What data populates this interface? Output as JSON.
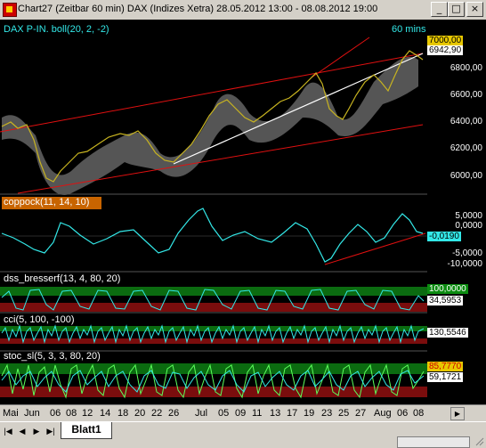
{
  "window": {
    "title": "Chart27 (Zeitbar 60 min)  DAX (Indizes Xetra) 28.05.2012 13:00 - 08.08.2012 19:00",
    "min_label": "_",
    "max_label": "□",
    "close_label": "×"
  },
  "main_panel": {
    "label": "DAX P-IN.  boll(20, 2, -2)",
    "interval": "60 mins",
    "price_tags": [
      "7000,00",
      "6942,90"
    ],
    "scale": [
      "6800,00",
      "6600,00",
      "6400,00",
      "6200,00",
      "6000,00"
    ]
  },
  "coppock": {
    "label": "coppock(11, 14, 10)",
    "value_tag": "-0,0190",
    "scale": [
      "5,0000",
      "0,0000",
      "-5,0000",
      "-10,0000"
    ]
  },
  "dss": {
    "label": "dss_bresserf(13, 4, 80, 20)",
    "value_tags": [
      "100,0000",
      "34,5953"
    ]
  },
  "cci": {
    "label": "cci(5, 100, -100)",
    "value_tag": "130,5546"
  },
  "stoc": {
    "label": "stoc_sl(5, 3, 3, 80, 20)",
    "value_tags": [
      "85,7770",
      "59,1721"
    ]
  },
  "x_axis": [
    "Mai",
    "Jun",
    "06",
    "08",
    "12",
    "14",
    "18",
    "20",
    "22",
    "26",
    "Jul",
    "05",
    "09",
    "11",
    "13",
    "17",
    "19",
    "23",
    "25",
    "27",
    "Aug",
    "06",
    "08"
  ],
  "sheet": {
    "tab_label": "Blatt1"
  },
  "colors": {
    "background": "#000000",
    "bollinger_band": "#6b6b6b",
    "channel": "#e01010",
    "trendline": "#ffffff",
    "oscillator": "#33e8e8",
    "zone_green": "#0b6b10",
    "zone_red": "#7a0d0d",
    "stoc_fast": "#5cff5c"
  }
}
